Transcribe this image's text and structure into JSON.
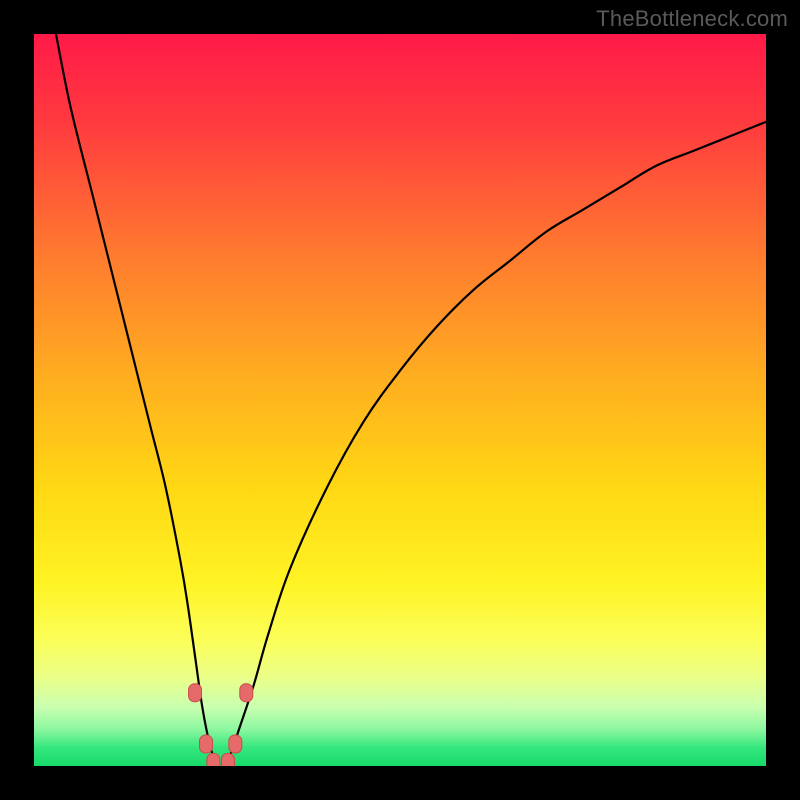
{
  "attribution": "TheBottleneck.com",
  "colors": {
    "frame": "#000000",
    "curve": "#000000",
    "marker_fill": "#e66a6a",
    "marker_stroke": "#c84b4b",
    "gradient_stops": [
      {
        "offset": "0%",
        "color": "#ff1a49"
      },
      {
        "offset": "12%",
        "color": "#ff3a3f"
      },
      {
        "offset": "30%",
        "color": "#ff7a2f"
      },
      {
        "offset": "48%",
        "color": "#ffb11f"
      },
      {
        "offset": "62%",
        "color": "#ffd814"
      },
      {
        "offset": "75%",
        "color": "#fff324"
      },
      {
        "offset": "83%",
        "color": "#fbff5a"
      },
      {
        "offset": "88%",
        "color": "#eaff8a"
      },
      {
        "offset": "92%",
        "color": "#c8ffb0"
      },
      {
        "offset": "95%",
        "color": "#8cf7a0"
      },
      {
        "offset": "97.5%",
        "color": "#35e77d"
      },
      {
        "offset": "100%",
        "color": "#17d96b"
      }
    ]
  },
  "chart_data": {
    "type": "line",
    "title": "",
    "xlabel": "",
    "ylabel": "",
    "xlim": [
      0,
      100
    ],
    "ylim": [
      0,
      100
    ],
    "grid": false,
    "legend": false,
    "series": [
      {
        "name": "bottleneck-curve",
        "x": [
          3,
          5,
          8,
          10,
          12,
          14,
          16,
          18,
          20,
          21,
          22,
          23,
          24,
          25,
          26,
          27,
          28,
          30,
          32,
          35,
          40,
          45,
          50,
          55,
          60,
          65,
          70,
          75,
          80,
          85,
          90,
          95,
          100
        ],
        "values": [
          100,
          90,
          78,
          70,
          62,
          54,
          46,
          38,
          28,
          22,
          15,
          8,
          3,
          0,
          0,
          2,
          5,
          11,
          18,
          27,
          38,
          47,
          54,
          60,
          65,
          69,
          73,
          76,
          79,
          82,
          84,
          86,
          88
        ]
      }
    ],
    "optimum_x": 25,
    "markers": [
      {
        "x": 22.0,
        "y": 10.0
      },
      {
        "x": 23.5,
        "y": 3.0
      },
      {
        "x": 24.5,
        "y": 0.5
      },
      {
        "x": 26.5,
        "y": 0.5
      },
      {
        "x": 27.5,
        "y": 3.0
      },
      {
        "x": 29.0,
        "y": 10.0
      }
    ]
  }
}
